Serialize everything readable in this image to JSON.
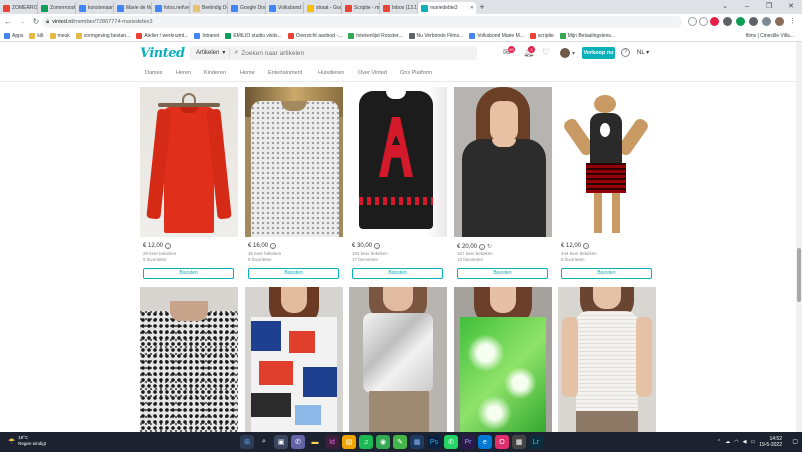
{
  "browser": {
    "tabs": [
      {
        "label": "ZOMERROO",
        "favicon_color": "#ea4335",
        "active": false
      },
      {
        "label": "Zomerrooste",
        "favicon_color": "#0f9d58",
        "active": false
      },
      {
        "label": "konstenaam",
        "favicon_color": "#4285f4",
        "active": false
      },
      {
        "label": "Marie de Wer",
        "favicon_color": "#4285f4",
        "active": false
      },
      {
        "label": "fotos.net\\vel",
        "favicon_color": "#4285f4",
        "active": false
      },
      {
        "label": "Beëindig De I",
        "favicon_color": "#e8c26e",
        "active": false
      },
      {
        "label": "Google Docs",
        "favicon_color": "#4285f4",
        "active": false
      },
      {
        "label": "Volksbond M",
        "favicon_color": "#4285f4",
        "active": false
      },
      {
        "label": "straat - Goog",
        "favicon_color": "#fbbc04",
        "active": false
      },
      {
        "label": "Scriptie - mar",
        "favicon_color": "#ea4335",
        "active": false
      },
      {
        "label": "Inbox (13.16)",
        "favicon_color": "#ea4335",
        "active": false
      },
      {
        "label": "mariedebie3",
        "favicon_color": "#09b1ba",
        "active": true
      }
    ],
    "new_tab": "+",
    "window_controls": [
      "⌄",
      "–",
      "❐",
      "✕"
    ],
    "address": {
      "host": "vinted.nl",
      "path": "/member/72867774-mariedebie3"
    },
    "bookmarks": [
      {
        "label": "Apps",
        "color": "#4285f4"
      },
      {
        "label": "kilt",
        "color": "#e8b949"
      },
      {
        "label": "meuk",
        "color": "#e8b949"
      },
      {
        "label": "vormgeving bestan...",
        "color": "#e8b949"
      },
      {
        "label": "Atelier / werkruimt...",
        "color": "#ea4335"
      },
      {
        "label": "Intranet",
        "color": "#4285f4"
      },
      {
        "label": "EMILIO studio visits...",
        "color": "#0f9d58"
      },
      {
        "label": "Overzicht aanbod -...",
        "color": "#ea4335"
      },
      {
        "label": "Intekenlijst Rooster...",
        "color": "#34a853"
      },
      {
        "label": "Nu Verbonde Films...",
        "color": "#5f6368"
      },
      {
        "label": "Volksbond Marie M...",
        "color": "#4285f4"
      },
      {
        "label": "scriptie",
        "color": "#ea4335"
      },
      {
        "label": "Mijn Betaalingslens...",
        "color": "#34a853"
      }
    ],
    "bookmark_more": "films | Cinecille Villa..."
  },
  "vinted": {
    "logo": "Vinted",
    "search_category": "Artikelen",
    "search_placeholder": "Zoeken naar artikelen",
    "message_badge": "60",
    "notification_badge": "3",
    "sell_button": "Verkoop nu",
    "help": "?",
    "language": "NL",
    "categories": [
      "Dames",
      "Heren",
      "Kinderen",
      "Home",
      "Entertainment",
      "Huisdieren",
      "Over Vinted",
      "Ons Platform"
    ]
  },
  "items": [
    {
      "price": "€ 12,00",
      "views": "20 keer bekeken",
      "favorites": "6 favorieten",
      "button": "Boosten"
    },
    {
      "price": "€ 16,00",
      "views": "35 keer bekeken",
      "favorites": "9 favorieten",
      "button": "Boosten"
    },
    {
      "price": "€ 30,00",
      "views": "104 keer bekeken",
      "favorites": "17 favorieten",
      "button": "Boosten"
    },
    {
      "price": "€ 20,00",
      "views": "167 keer bekeken",
      "favorites": "10 favorieten",
      "button": "Boosten"
    },
    {
      "price": "€ 12,00",
      "views": "444 keer bekeken",
      "favorites": "8 favorieten",
      "button": "Boosten"
    }
  ],
  "taskbar": {
    "temperature": "18°C",
    "weather": "Regen eindigt",
    "time": "14:52",
    "date": "19-5-2022"
  }
}
